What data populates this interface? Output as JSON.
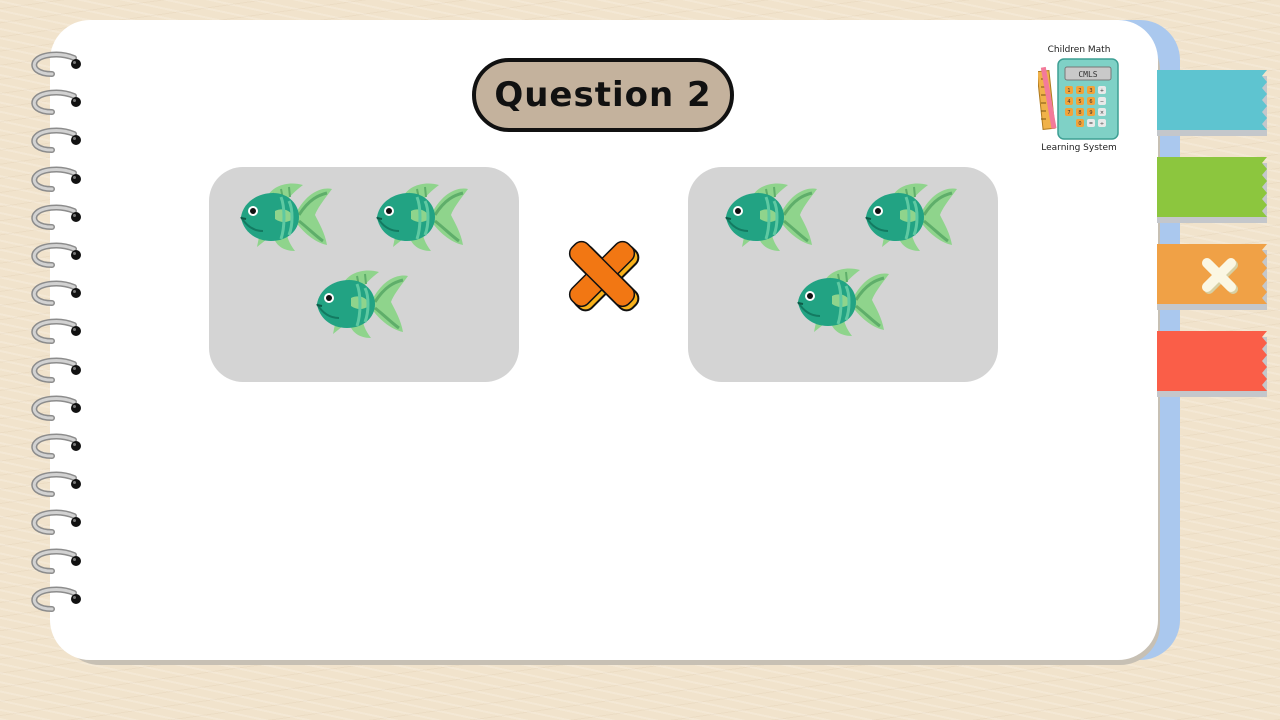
{
  "question": {
    "title": "Question 2"
  },
  "operator": {
    "symbol": "multiply"
  },
  "groups": [
    {
      "item": "fish-icon",
      "count": 3
    },
    {
      "item": "fish-icon",
      "count": 3
    }
  ],
  "logo": {
    "title": "Children Math",
    "subtitle": "Learning System",
    "screen_text": "CMLS"
  },
  "side_tabs": [
    {
      "color": "#5ec4d0"
    },
    {
      "color": "#8cc63e"
    },
    {
      "color": "#f0a146",
      "icon": "multiply-icon"
    },
    {
      "color": "#fa5e48"
    }
  ],
  "colors": {
    "background": "#f1e3cc",
    "page": "#ffffff",
    "title_pill": "#c4b29d",
    "group_box": "#d4d4d4",
    "fish_body": "#22a383",
    "fish_fin": "#8fd48c",
    "operator": "#f27713"
  }
}
